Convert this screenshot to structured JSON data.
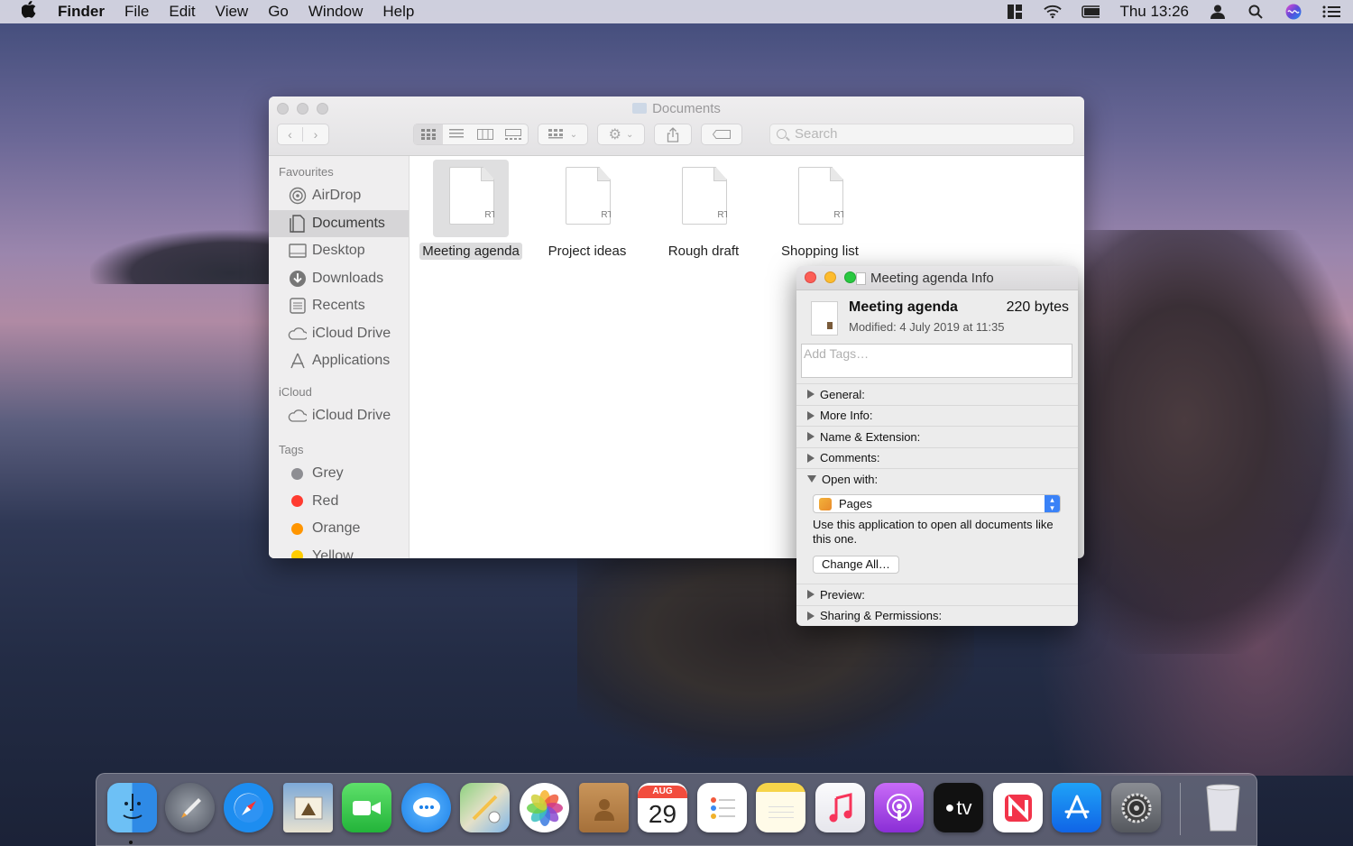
{
  "menubar": {
    "app": "Finder",
    "menus": [
      "File",
      "Edit",
      "View",
      "Go",
      "Window",
      "Help"
    ],
    "clock": "Thu 13:26"
  },
  "finder": {
    "title": "Documents",
    "search_placeholder": "Search",
    "sidebar": {
      "favourites_heading": "Favourites",
      "favourites": [
        "AirDrop",
        "Documents",
        "Desktop",
        "Downloads",
        "Recents",
        "iCloud Drive",
        "Applications"
      ],
      "selected": "Documents",
      "icloud_heading": "iCloud",
      "icloud": [
        "iCloud Drive"
      ],
      "tags_heading": "Tags",
      "tags": [
        {
          "label": "Grey",
          "color": "#8e8e93"
        },
        {
          "label": "Red",
          "color": "#ff3b30"
        },
        {
          "label": "Orange",
          "color": "#ff9500"
        },
        {
          "label": "Yellow",
          "color": "#ffcc00"
        }
      ]
    },
    "files": [
      {
        "name": "Meeting agenda",
        "ext": "RTF",
        "selected": true
      },
      {
        "name": "Project ideas",
        "ext": "RTF",
        "selected": false
      },
      {
        "name": "Rough draft",
        "ext": "RTF",
        "selected": false
      },
      {
        "name": "Shopping list",
        "ext": "RTF",
        "selected": false
      }
    ]
  },
  "info": {
    "title": "Meeting agenda Info",
    "file_name": "Meeting agenda",
    "size": "220 bytes",
    "modified": "Modified: 4 July 2019 at 11:35",
    "tags_placeholder": "Add Tags…",
    "sections": {
      "general": "General:",
      "more_info": "More Info:",
      "name_ext": "Name & Extension:",
      "comments": "Comments:",
      "open_with": "Open with:",
      "preview": "Preview:",
      "sharing": "Sharing & Permissions:"
    },
    "open_with_app": "Pages",
    "open_with_note": "Use this application to open all documents like this one.",
    "change_all": "Change All…"
  },
  "dock": {
    "apps": [
      "Finder",
      "Launchpad",
      "Safari",
      "Mail",
      "FaceTime",
      "Messages",
      "Maps",
      "Photos",
      "Contacts",
      "Calendar",
      "Reminders",
      "Notes",
      "Music",
      "Podcasts",
      "TV",
      "News",
      "App Store",
      "System Preferences",
      "Trash"
    ],
    "calendar_month": "AUG",
    "calendar_day": "29",
    "tv_label": "tv"
  }
}
